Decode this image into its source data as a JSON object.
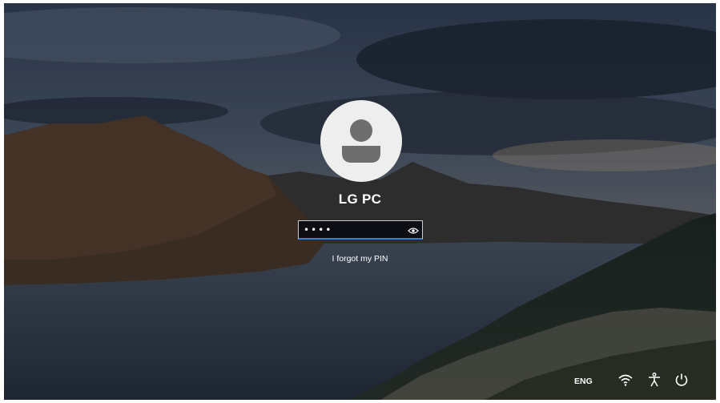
{
  "login": {
    "username": "LG PC",
    "pin_value": "••••",
    "forgot_label": "I forgot my PIN"
  },
  "tray": {
    "language": "ENG",
    "network_icon": "wifi-icon",
    "accessibility_icon": "accessibility-icon",
    "power_icon": "power-icon"
  },
  "colors": {
    "accent": "#3a7bd5",
    "avatar_bg": "#eeeeee",
    "avatar_figure": "#6e6e6e"
  }
}
